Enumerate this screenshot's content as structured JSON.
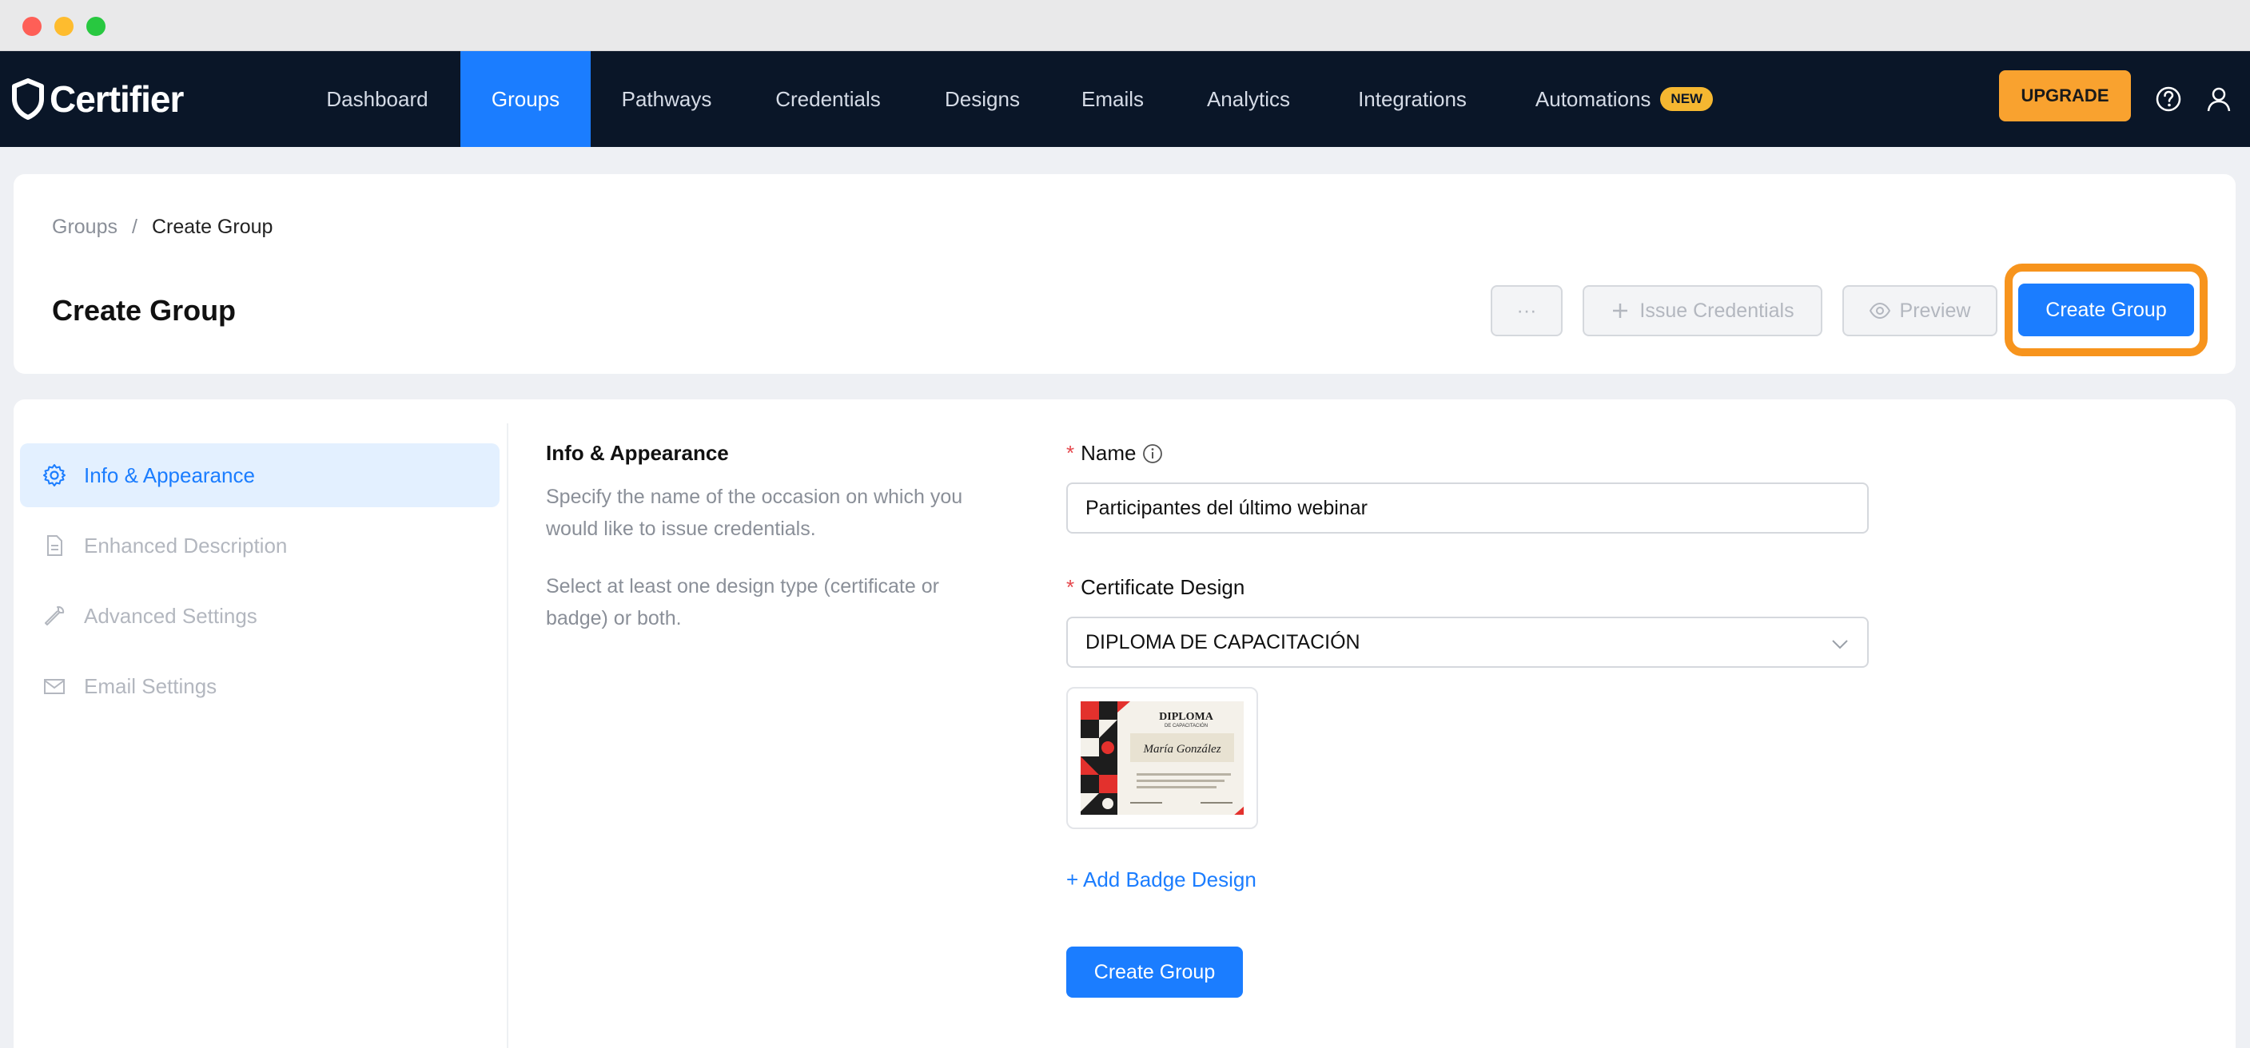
{
  "nav": {
    "logo": "Certifier",
    "items": [
      {
        "label": "Dashboard",
        "active": false
      },
      {
        "label": "Groups",
        "active": true
      },
      {
        "label": "Pathways",
        "active": false
      },
      {
        "label": "Credentials",
        "active": false
      },
      {
        "label": "Designs",
        "active": false
      },
      {
        "label": "Emails",
        "active": false
      },
      {
        "label": "Analytics",
        "active": false
      },
      {
        "label": "Integrations",
        "active": false
      },
      {
        "label": "Automations",
        "active": false
      }
    ],
    "new_badge": "NEW",
    "upgrade": "UPGRADE"
  },
  "header": {
    "breadcrumb": [
      "Groups",
      "/",
      "Create Group"
    ],
    "title": "Create Group",
    "more_label": "···",
    "issue_label": "Issue Credentials",
    "preview_label": "Preview",
    "create_label": "Create Group"
  },
  "sidebar": {
    "items": [
      {
        "label": "Info & Appearance",
        "icon": "gear-icon",
        "active": true
      },
      {
        "label": "Enhanced Description",
        "icon": "document-icon",
        "active": false
      },
      {
        "label": "Advanced Settings",
        "icon": "wrench-icon",
        "active": false
      },
      {
        "label": "Email Settings",
        "icon": "envelope-icon",
        "active": false
      }
    ]
  },
  "section": {
    "title": "Info & Appearance",
    "desc1": "Specify the name of the occasion on which you would like to issue credentials.",
    "desc2": "Select at least one design type (certificate or badge) or both."
  },
  "form": {
    "name_label": "Name",
    "name_value": "Participantes del último webinar",
    "design_label": "Certificate Design",
    "design_value": "DIPLOMA DE CAPACITACIÓN",
    "add_badge": "+ Add Badge Design",
    "submit": "Create Group",
    "required_mark": "*"
  },
  "thumbnail": {
    "heading": "DIPLOMA",
    "sub": "DE CAPACITACIÓN",
    "name": "María González"
  },
  "colors": {
    "nav_bg": "#0a1628",
    "accent": "#1b7dff",
    "upgrade": "#f9a22f",
    "highlight": "#f7941d"
  }
}
